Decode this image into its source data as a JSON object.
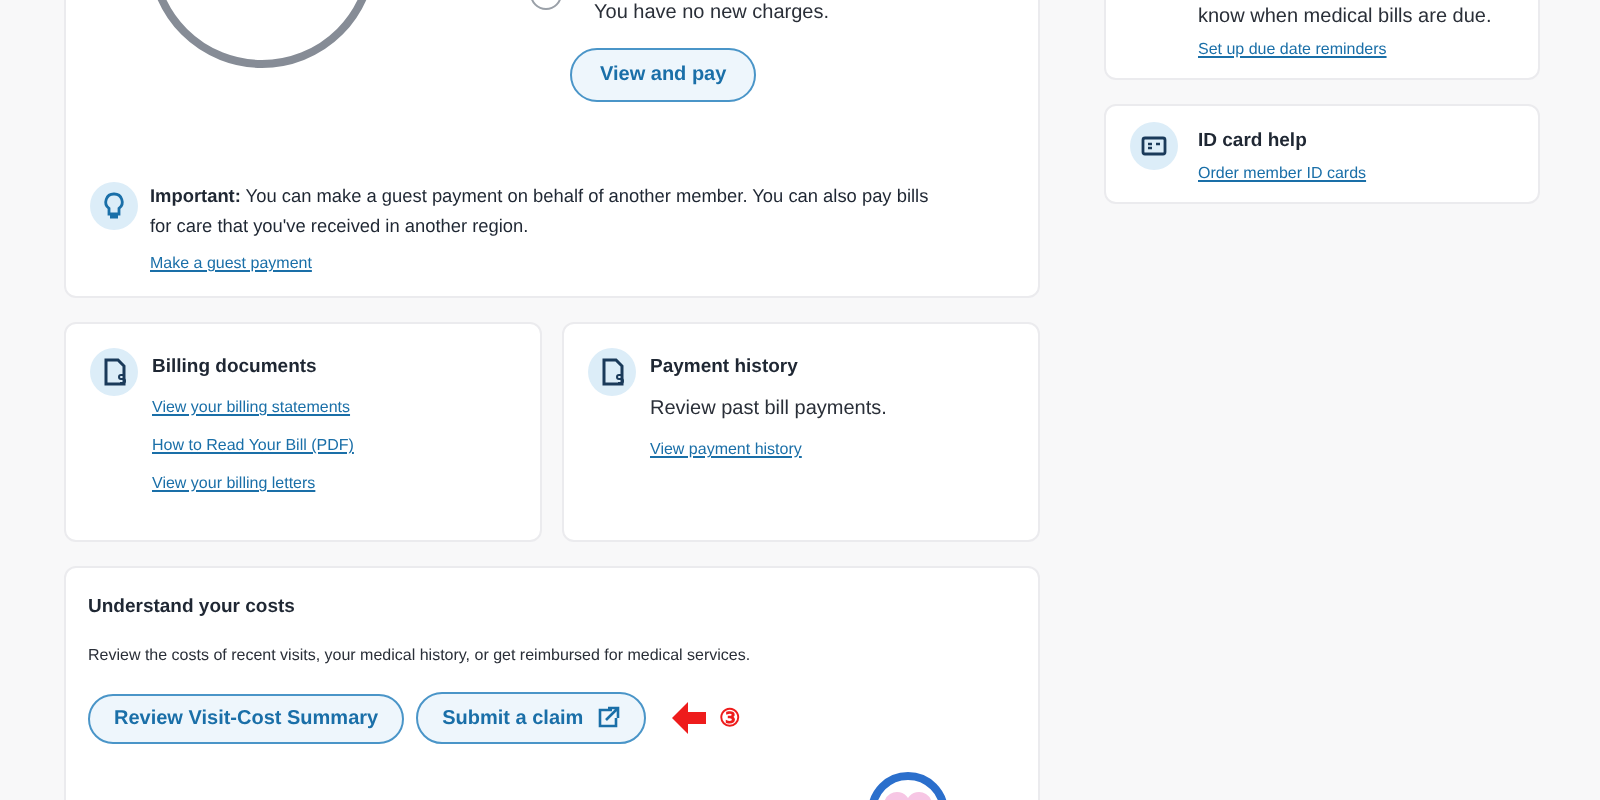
{
  "balance": {
    "status": "You have no new charges.",
    "selected": false,
    "button": "View and pay"
  },
  "important": {
    "text": "**Important:** You can make a guest payment on behalf of another member. You can also pay bills for care that you've received in another region.",
    "link": "Make a guest payment"
  },
  "billing_documents": {
    "title": "Billing documents",
    "links": [
      "View your billing statements",
      "How to Read Your Bill (PDF)",
      "View your billing letters"
    ]
  },
  "payment_history": {
    "title": "Payment history",
    "text": "Review past bill payments.",
    "link": "View payment history"
  },
  "costs": {
    "title": "Understand your costs",
    "text": "Review the costs of recent visits, your medical history, or get reimbursed for medical services.",
    "buttons": [
      {
        "label": "Review Visit-Cost Summary",
        "external": false
      },
      {
        "label": "Submit a claim",
        "external": true
      }
    ],
    "annotation": "③"
  },
  "reminders": {
    "text": "know when medical bills are due.",
    "link": "Set up due date reminders"
  },
  "id_card": {
    "title": "ID card help",
    "link": "Order member ID cards"
  }
}
